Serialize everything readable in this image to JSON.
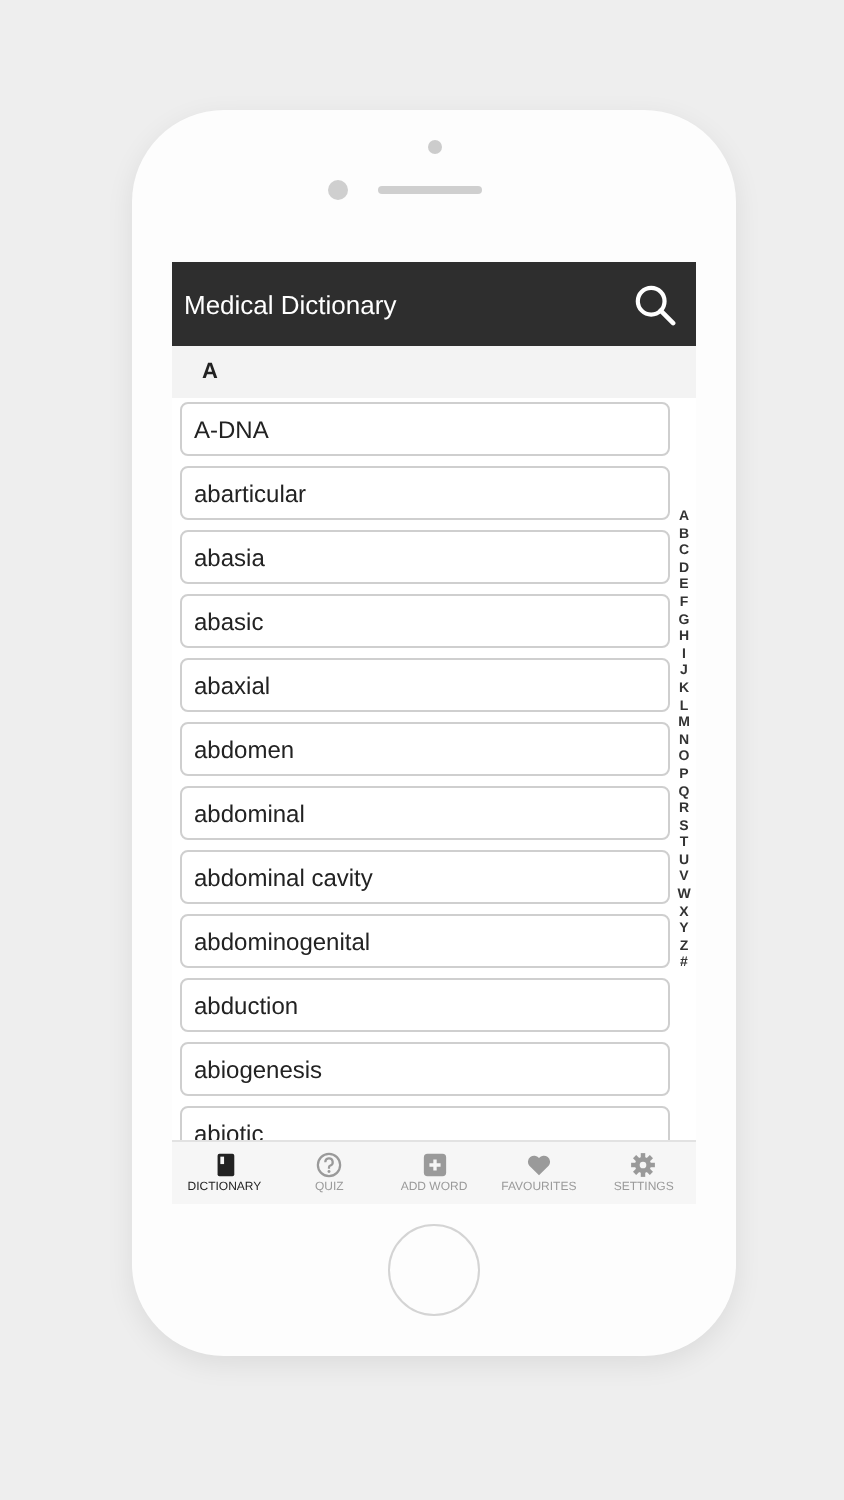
{
  "app_bar": {
    "title": "Medical Dictionary"
  },
  "section": {
    "heading": "A"
  },
  "words": [
    "A-DNA",
    "abarticular",
    "abasia",
    "abasic",
    "abaxial",
    "abdomen",
    "abdominal",
    "abdominal cavity",
    "abdominogenital",
    "abduction",
    "abiogenesis",
    "abiotic"
  ],
  "index": [
    "A",
    "B",
    "C",
    "D",
    "E",
    "F",
    "G",
    "H",
    "I",
    "J",
    "K",
    "L",
    "M",
    "N",
    "O",
    "P",
    "Q",
    "R",
    "S",
    "T",
    "U",
    "V",
    "W",
    "X",
    "Y",
    "Z",
    "#"
  ],
  "tabs": [
    {
      "label": "DICTIONARY",
      "selected": true
    },
    {
      "label": "QUIZ",
      "selected": false
    },
    {
      "label": "ADD WORD",
      "selected": false
    },
    {
      "label": "FAVOURITES",
      "selected": false
    },
    {
      "label": "SETTINGS",
      "selected": false
    }
  ]
}
